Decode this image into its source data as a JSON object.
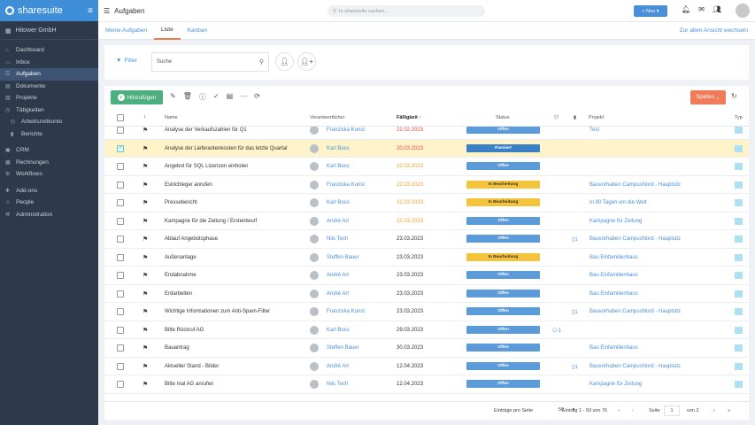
{
  "app": {
    "brand": "sharesuite",
    "company": "Hitower GmbH"
  },
  "sidebar": {
    "items": [
      {
        "label": "Dashboard",
        "icon": "home-icon"
      },
      {
        "label": "Inbox",
        "icon": "inbox-icon"
      },
      {
        "label": "Aufgaben",
        "icon": "tasks-icon",
        "active": true
      },
      {
        "label": "Dokumente",
        "icon": "document-icon"
      },
      {
        "label": "Projekte",
        "icon": "folder-icon"
      },
      {
        "label": "Tätigkeiten",
        "icon": "clock-icon"
      },
      {
        "label": "Arbeitszeitkonto",
        "icon": "timesheet-icon",
        "sub": true
      },
      {
        "label": "Berichte",
        "icon": "chart-icon",
        "sub": true
      },
      {
        "label": "CRM",
        "icon": "crm-icon"
      },
      {
        "label": "Rechnungen",
        "icon": "invoice-icon"
      },
      {
        "label": "Workflows",
        "icon": "workflow-icon"
      },
      {
        "label": "Add-ons",
        "icon": "addon-icon"
      },
      {
        "label": "People",
        "icon": "people-icon"
      },
      {
        "label": "Administration",
        "icon": "admin-icon"
      }
    ]
  },
  "topbar": {
    "title": "Aufgaben",
    "search_placeholder": "In sharesuite suchen...",
    "new_button": "Neu"
  },
  "tabs": {
    "items": [
      "Meine Aufgaben",
      "Liste",
      "Kanban"
    ],
    "active": "Liste",
    "right_link": "Zur alten Ansicht wechseln"
  },
  "filter": {
    "label": "Filter",
    "search_value": "Suche"
  },
  "toolbar": {
    "add_label": "Hinzufügen",
    "columns_label": "Spalten"
  },
  "table": {
    "headers": {
      "priority": "!",
      "name": "Name",
      "responsible": "Verantwortlicher",
      "due": "Fälligkeit",
      "status": "Status",
      "project": "Projekt",
      "type": "Typ"
    },
    "rows": [
      {
        "name": "Analyse der Verkaufszahlen für Q1",
        "person": "Franziska Kunst",
        "date": "22.02.2023",
        "date_color": "red",
        "status": "Offen",
        "status_type": "offen",
        "comments": "",
        "docs": "",
        "project": "Test"
      },
      {
        "name": "Analyse der Lieferantenkosten für das letzte Quartal",
        "person": "Karl Boss",
        "date": "20.03.2023",
        "date_color": "red",
        "status": "Passiert",
        "status_type": "passiert",
        "comments": "",
        "docs": "",
        "project": "",
        "selected": true
      },
      {
        "name": "Angebot für SQL Lizenzen einholen",
        "person": "Karl Boss",
        "date": "22.03.2023",
        "date_color": "orange",
        "status": "Offen",
        "status_type": "offen",
        "comments": "",
        "docs": "",
        "project": ""
      },
      {
        "name": "Estrichleger anrufen",
        "person": "Franziska Kunst",
        "date": "22.03.2023",
        "date_color": "orange",
        "status": "In Bearbeitung",
        "status_type": "inb",
        "comments": "",
        "docs": "",
        "project": "Bauvorhaben CampusNord - Hauptsitz"
      },
      {
        "name": "Pressebericht",
        "person": "Karl Boss",
        "date": "22.03.2023",
        "date_color": "orange",
        "status": "In Bearbeitung",
        "status_type": "inb",
        "comments": "",
        "docs": "",
        "project": "In 80 Tagen um die Welt"
      },
      {
        "name": "Kampagne für die Zeitung / Erstentwurf",
        "person": "André Art",
        "date": "22.03.2023",
        "date_color": "orange",
        "status": "Offen",
        "status_type": "offen",
        "comments": "",
        "docs": "",
        "project": "Kampagne für Zeitung"
      },
      {
        "name": "Ablauf Angebotsphase",
        "person": "Nils Tech",
        "date": "23.03.2023",
        "date_color": "",
        "status": "Offen",
        "status_type": "offen",
        "comments": "",
        "docs": "1",
        "project": "Bauvorhaben CampusNord - Hauptsitz"
      },
      {
        "name": "Außenanlage",
        "person": "Steffen Bauer",
        "date": "23.03.2023",
        "date_color": "",
        "status": "In Bearbeitung",
        "status_type": "inb",
        "comments": "",
        "docs": "",
        "project": "Bau Einfamilienhaus"
      },
      {
        "name": "Endabnahme",
        "person": "André Art",
        "date": "23.03.2023",
        "date_color": "",
        "status": "Offen",
        "status_type": "offen",
        "comments": "",
        "docs": "",
        "project": "Bau Einfamilienhaus"
      },
      {
        "name": "Erdarbeiten",
        "person": "André Art",
        "date": "23.03.2023",
        "date_color": "",
        "status": "Offen",
        "status_type": "offen",
        "comments": "",
        "docs": "",
        "project": "Bau Einfamilienhaus"
      },
      {
        "name": "Wichtige Informationen zum Anti-Spam-Filter",
        "person": "Franziska Kunst",
        "date": "23.03.2023",
        "date_color": "",
        "status": "Offen",
        "status_type": "offen",
        "comments": "",
        "docs": "1",
        "project": "Bauvorhaben CampusNord - Hauptsitz"
      },
      {
        "name": "Bitte Rückruf AG",
        "person": "Karl Boss",
        "date": "29.03.2023",
        "date_color": "",
        "status": "Offen",
        "status_type": "offen",
        "comments": "1",
        "docs": "",
        "project": ""
      },
      {
        "name": "Bauantrag",
        "person": "Steffen Bauer",
        "date": "30.03.2023",
        "date_color": "",
        "status": "Offen",
        "status_type": "offen",
        "comments": "",
        "docs": "",
        "project": "Bau Einfamilienhaus"
      },
      {
        "name": "Aktueller Stand - Bilder",
        "person": "André Art",
        "date": "12.04.2023",
        "date_color": "",
        "status": "Offen",
        "status_type": "offen",
        "comments": "",
        "docs": "1",
        "project": "Bauvorhaben CampusNord - Hauptsitz"
      },
      {
        "name": "Bitte mal AG anrufen",
        "person": "Nils Tech",
        "date": "12.04.2023",
        "date_color": "",
        "status": "Offen",
        "status_type": "offen",
        "comments": "",
        "docs": "",
        "project": "Kampagne für Zeitung"
      }
    ]
  },
  "pagination": {
    "per_page_label": "Einträge pro Seite",
    "per_page_value": "50",
    "range": "Eintrag 1 - 50 von 76",
    "page_label": "Seite",
    "page_value": "1",
    "of_label": "von 2"
  },
  "colors": {
    "accent": "#4a90d9",
    "sidebar": "#2d3a4b",
    "add": "#4caf7d",
    "columns": "#f07b5a"
  }
}
